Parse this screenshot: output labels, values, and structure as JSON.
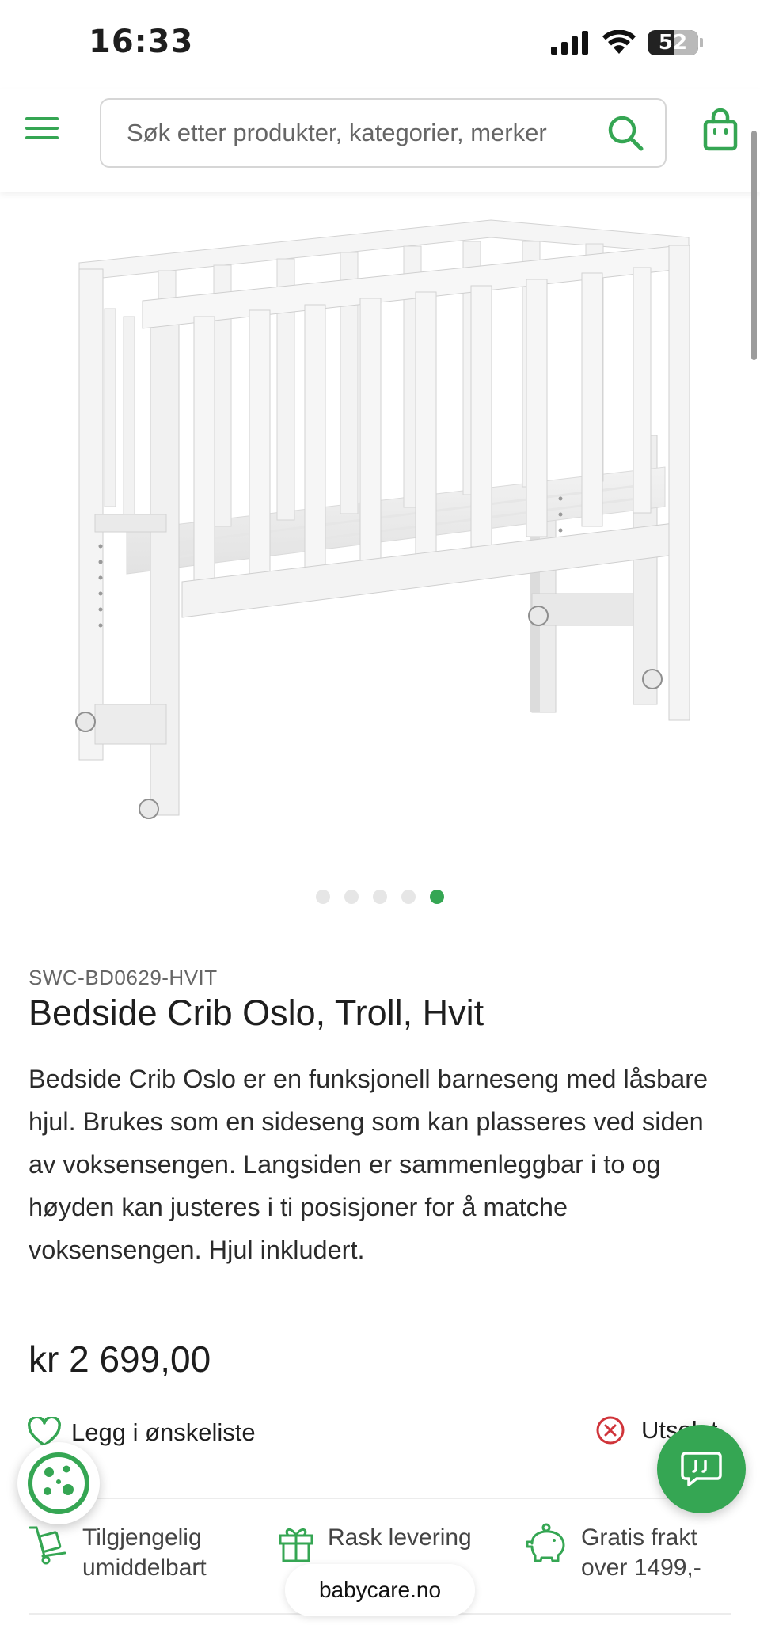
{
  "status_bar": {
    "time": "16:33",
    "battery": "52",
    "battery_level": 0.52
  },
  "header": {
    "search": {
      "placeholder": "Søk etter produkter, kategorier, merker"
    }
  },
  "gallery": {
    "total_images": 5,
    "active_index": 4
  },
  "product": {
    "sku": "SWC-BD0629-HVIT",
    "title": "Bedside Crib Oslo, Troll, Hvit",
    "description": "Bedside Crib Oslo er en funksjonell barneseng med låsbare hjul. Brukes som en sideseng som kan plasseres ved siden av voksensengen. Langsiden er sammenleggbar i to og høyden kan justeres i ti posisjoner for å matche voksensengen. Hjul inkludert.",
    "price": "kr 2 699,00"
  },
  "actions": {
    "wishlist_label": "Legg i ønskeliste",
    "stock_label": "Utsolgt"
  },
  "features": [
    {
      "icon": "delivery-cart-icon",
      "text": "Tilgjengelig umiddelbart"
    },
    {
      "icon": "gift-icon",
      "text": "Rask levering"
    },
    {
      "icon": "piggy-bank-icon",
      "text": "Gratis frakt over 1499,-"
    }
  ],
  "browser": {
    "domain": "babycare.no"
  },
  "colors": {
    "brand_green": "#35a653",
    "stock_red": "#d0343a",
    "text": "#1e1e1e"
  }
}
